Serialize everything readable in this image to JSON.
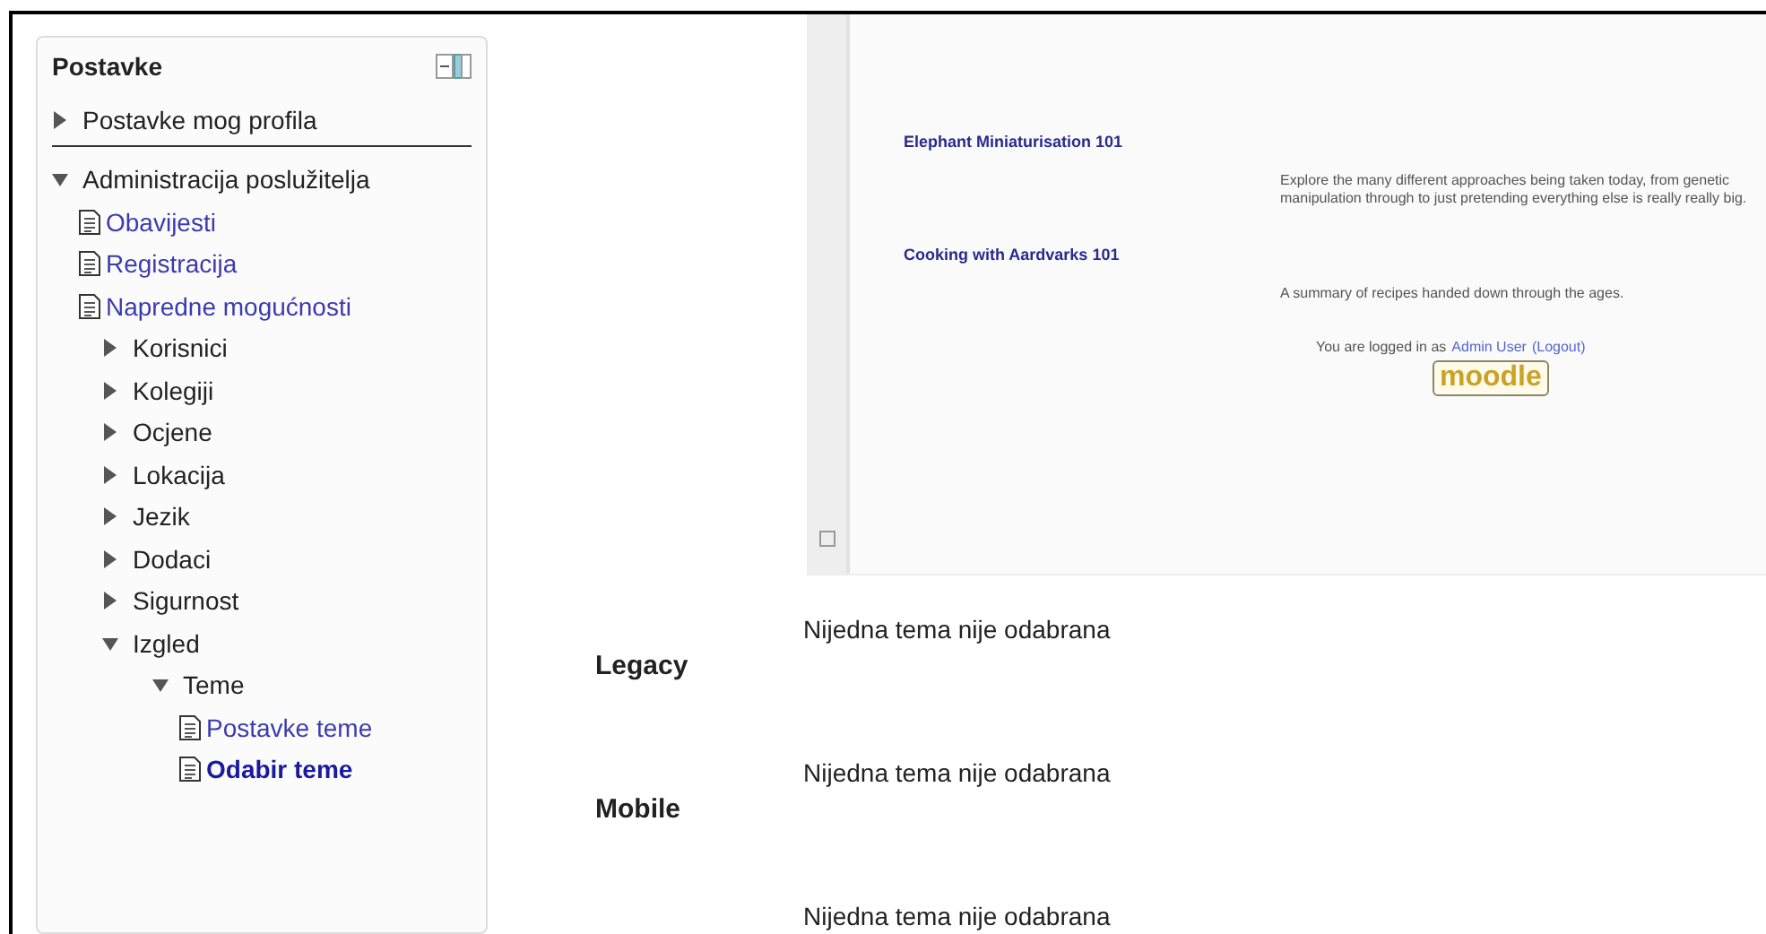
{
  "block": {
    "title": "Postavke",
    "tree": [
      {
        "label": "Postavke mog profila",
        "kind": "branch",
        "expanded": false,
        "divider": true
      },
      {
        "label": "Administracija poslužitelja",
        "kind": "branch",
        "expanded": true,
        "children": [
          {
            "label": "Obavijesti",
            "kind": "leaf",
            "selected": false
          },
          {
            "label": "Registracija",
            "kind": "leaf",
            "selected": false
          },
          {
            "label": "Napredne mogućnosti",
            "kind": "leaf",
            "selected": false
          },
          {
            "label": "Korisnici",
            "kind": "branch",
            "expanded": false
          },
          {
            "label": "Kolegiji",
            "kind": "branch",
            "expanded": false
          },
          {
            "label": "Ocjene",
            "kind": "branch",
            "expanded": false
          },
          {
            "label": "Lokacija",
            "kind": "branch",
            "expanded": false
          },
          {
            "label": "Jezik",
            "kind": "branch",
            "expanded": false
          },
          {
            "label": "Dodaci",
            "kind": "branch",
            "expanded": false
          },
          {
            "label": "Sigurnost",
            "kind": "branch",
            "expanded": false
          },
          {
            "label": "Izgled",
            "kind": "branch",
            "expanded": true,
            "children": [
              {
                "label": "Teme",
                "kind": "branch",
                "expanded": true,
                "children": [
                  {
                    "label": "Postavke teme",
                    "kind": "leaf",
                    "selected": false
                  },
                  {
                    "label": "Odabir teme",
                    "kind": "leaf",
                    "selected": true
                  }
                ]
              }
            ]
          }
        ]
      }
    ]
  },
  "preview": {
    "courses": [
      {
        "title": "Elephant Miniaturisation 101",
        "summary": "Explore the many different approaches being taken today, from genetic manipulation through to just pretending everything else is really really big."
      },
      {
        "title": "Cooking with Aardvarks 101",
        "summary": "A summary of recipes handed down through the ages."
      }
    ],
    "login": {
      "text": "You are logged in as",
      "user": "Admin User",
      "logout": "(Logout)"
    },
    "logo": "moodle"
  },
  "themes": [
    {
      "device": "Legacy",
      "value": "Nijedna tema nije odabrana"
    },
    {
      "device": "Mobile",
      "value": "Nijedna tema nije odabrana"
    },
    {
      "value": "Nijedna tema nije odabrana"
    }
  ]
}
